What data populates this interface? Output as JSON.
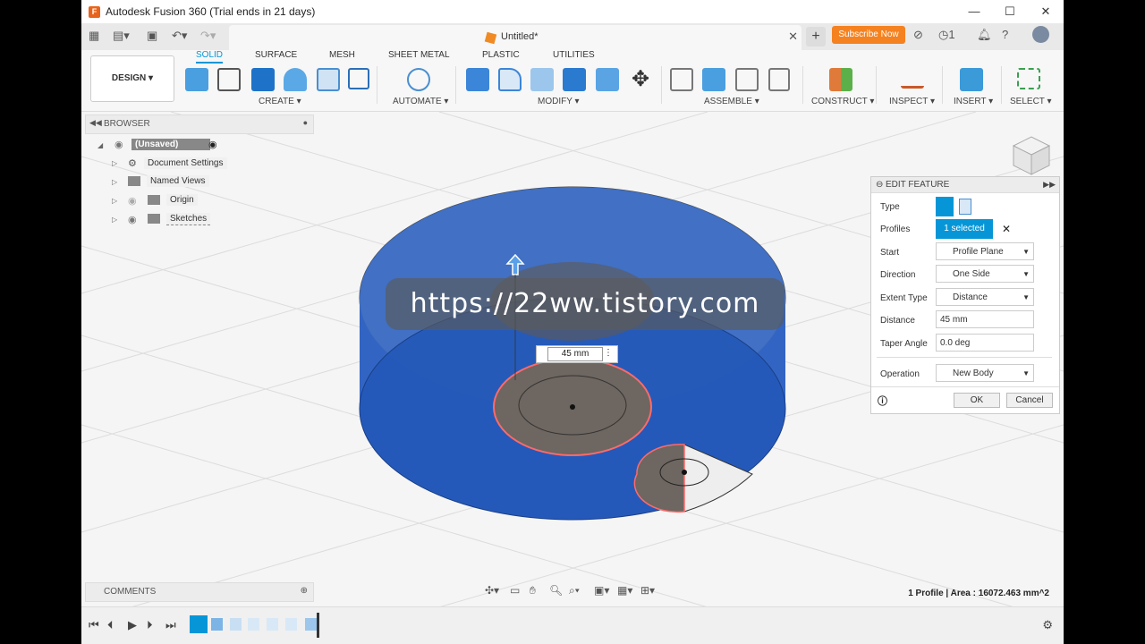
{
  "window": {
    "title": "Autodesk Fusion 360 (Trial ends in 21 days)",
    "min": "—",
    "max": "☐",
    "close": "✕"
  },
  "tabbar": {
    "doc_name": "Untitled*",
    "close": "✕",
    "plus": "+",
    "subscribe": "Subscribe Now",
    "jobs_count": "1"
  },
  "toolbar": {
    "workspace": "DESIGN ▾",
    "tabs": [
      "SOLID",
      "SURFACE",
      "MESH",
      "SHEET METAL",
      "PLASTIC",
      "UTILITIES"
    ],
    "groups": [
      "CREATE ▾",
      "AUTOMATE ▾",
      "MODIFY ▾",
      "ASSEMBLE ▾",
      "CONSTRUCT ▾",
      "INSPECT ▾",
      "INSERT ▾",
      "SELECT ▾"
    ]
  },
  "browser": {
    "title": "BROWSER",
    "root": "(Unsaved)",
    "items": [
      "Document Settings",
      "Named Views",
      "Origin",
      "Sketches"
    ]
  },
  "comments": {
    "title": "COMMENTS"
  },
  "edit_feature": {
    "title": "EDIT FEATURE",
    "rows": {
      "type": "Type",
      "profiles": "Profiles",
      "profiles_value": "1 selected",
      "start": "Start",
      "start_value": "Profile Plane",
      "direction": "Direction",
      "direction_value": "One Side",
      "extent_type": "Extent Type",
      "extent_type_value": "Distance",
      "distance": "Distance",
      "distance_value": "45 mm",
      "taper": "Taper Angle",
      "taper_value": "0.0 deg",
      "operation": "Operation",
      "operation_value": "New Body"
    },
    "ok": "OK",
    "cancel": "Cancel"
  },
  "viewport": {
    "dimension_input": "45 mm",
    "watermark": "https://22ww.tistory.com",
    "status": "1 Profile | Area : 16072.463 mm^2"
  },
  "icons": [
    "grid-icon",
    "file-icon",
    "save-icon",
    "undo-icon",
    "redo-icon",
    "gear-icon",
    "view-cube"
  ]
}
